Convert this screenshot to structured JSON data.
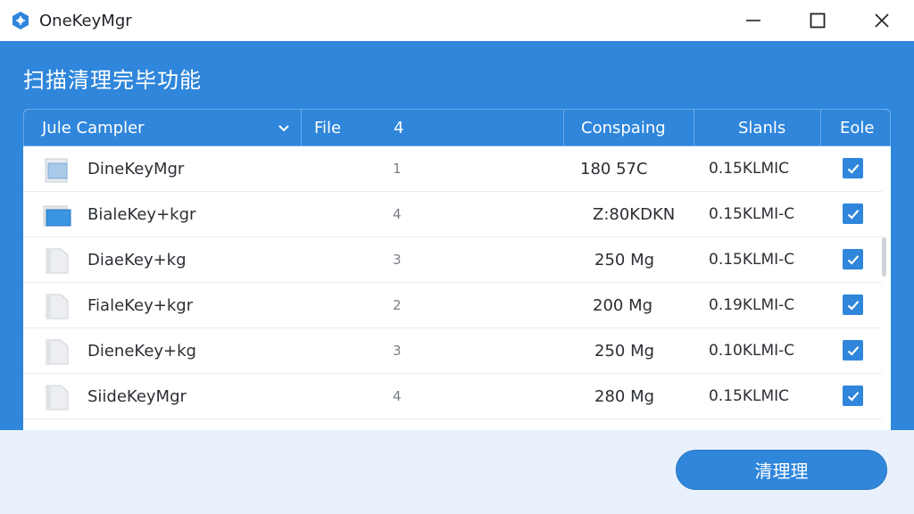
{
  "window": {
    "title": "OneKeyMgr",
    "icon": "app-logo-icon",
    "controls": [
      "minimize-icon",
      "maximize-icon",
      "close-icon"
    ]
  },
  "section": {
    "title": "扫描清理完毕功能"
  },
  "table": {
    "headers": {
      "name": "Jule Campler",
      "file": "File",
      "file_count": "4",
      "size": "Conspaing",
      "status": "Slanls",
      "check": "Eole"
    },
    "rows": [
      {
        "name": "DineKeyMgr",
        "count": "1",
        "size": "180 57C",
        "status": "0.15KLMIC",
        "checked": true,
        "icon": "folder-icon"
      },
      {
        "name": "BialeKey+kgr",
        "count": "4",
        "size": "Z:80KDKN",
        "status": "0.15KLMI-C",
        "checked": true,
        "icon": "folder-blue-icon"
      },
      {
        "name": "DiaeKey+kg",
        "count": "3",
        "size": "250 Mg",
        "status": "0.15KLMI-C",
        "checked": true,
        "icon": "file-icon"
      },
      {
        "name": "FialeKey+kgr",
        "count": "2",
        "size": "200 Mg",
        "status": "0.19KLMI-C",
        "checked": true,
        "icon": "file-icon"
      },
      {
        "name": "DieneKey+kg",
        "count": "3",
        "size": "250 Mg",
        "status": "0.10KLMI-C",
        "checked": true,
        "icon": "file-icon"
      },
      {
        "name": "SiideKeyMgr",
        "count": "4",
        "size": "280 Mg",
        "status": "0.15KLMIC",
        "checked": true,
        "icon": "file-icon"
      }
    ]
  },
  "footer": {
    "clean_label": "清理理"
  },
  "colors": {
    "accent": "#2f86db",
    "footer_bg": "#e8f1fb"
  }
}
